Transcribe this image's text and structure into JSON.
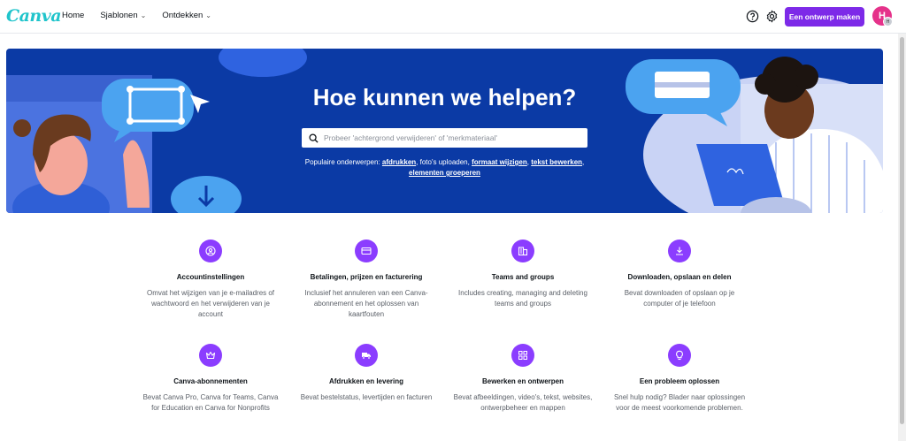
{
  "header": {
    "logo": "Canva",
    "nav": [
      {
        "label": "Home"
      },
      {
        "label": "Sjablonen",
        "has_dropdown": true
      },
      {
        "label": "Ontdekken",
        "has_dropdown": true
      }
    ],
    "help_icon": "question-circle-icon",
    "settings_icon": "gear-icon",
    "cta_label": "Een ontwerp maken",
    "avatar_initial": "H",
    "avatar_badge": "H",
    "accent_color": "#7d2ae8"
  },
  "hero": {
    "title": "Hoe kunnen we helpen?",
    "search_placeholder": "Probeer 'achtergrond verwijderen' of 'merkmateriaal'",
    "search_value": "",
    "popular_label": "Populaire onderwerpen:",
    "topics": [
      {
        "label": "afdrukken",
        "link": true
      },
      {
        "label": "foto's uploaden",
        "link": false
      },
      {
        "label": "formaat wijzigen",
        "link": true
      },
      {
        "label": "tekst bewerken",
        "link": true
      },
      {
        "label": "elementen groeperen",
        "link": true
      }
    ],
    "background_color": "#0b3aa5"
  },
  "categories": [
    {
      "title": "Accountinstellingen",
      "description": "Omvat het wijzigen van je e-mailadres of wachtwoord en het verwijderen van je account",
      "icon": "account-icon"
    },
    {
      "title": "Betalingen, prijzen en facturering",
      "description": "Inclusief het annuleren van een Canva-abonnement en het oplossen van kaartfouten",
      "icon": "credit-card-icon"
    },
    {
      "title": "Teams and groups",
      "description": "Includes creating, managing and deleting teams and groups",
      "icon": "building-icon"
    },
    {
      "title": "Downloaden, opslaan en delen",
      "description": "Bevat downloaden of opslaan op je computer of je telefoon",
      "icon": "download-icon"
    },
    {
      "title": "Canva-abonnementen",
      "description": "Bevat Canva Pro, Canva for Teams, Canva for Education en Canva for Nonprofits",
      "icon": "crown-icon"
    },
    {
      "title": "Afdrukken en levering",
      "description": "Bevat bestelstatus, levertijden en facturen",
      "icon": "truck-icon"
    },
    {
      "title": "Bewerken en ontwerpen",
      "description": "Bevat afbeeldingen, video's, tekst, websites, ontwerpbeheer en mappen",
      "icon": "grid-icon"
    },
    {
      "title": "Een probleem oplossen",
      "description": "Snel hulp nodig? Blader naar oplossingen voor de meest voorkomende problemen.",
      "icon": "lightbulb-icon"
    }
  ]
}
